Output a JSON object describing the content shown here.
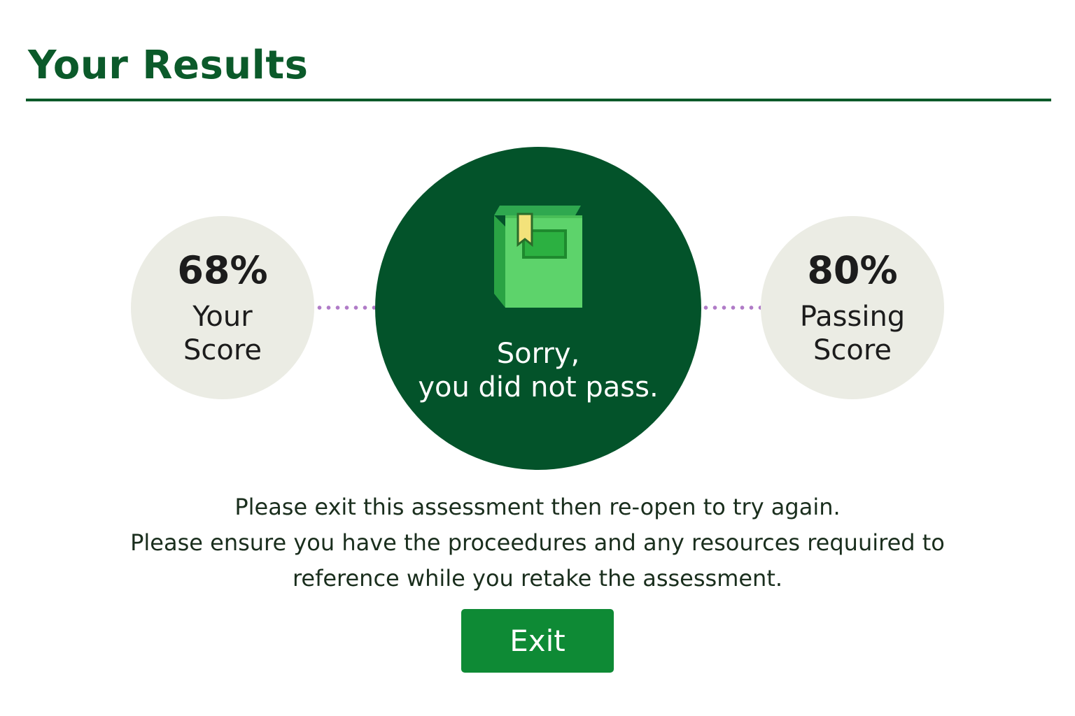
{
  "header": {
    "title": "Your Results"
  },
  "your_score": {
    "value": "68%",
    "label_line1": "Your",
    "label_line2": "Score"
  },
  "passing_score": {
    "value": "80%",
    "label_line1": "Passing",
    "label_line2": "Score"
  },
  "result": {
    "icon": "book-icon",
    "line1": "Sorry,",
    "line2": "you did not pass."
  },
  "instructions": {
    "line1": "Please exit this assessment then re-open to try again.",
    "line2": "Please ensure you have the proceedures and any resources requuired to",
    "line3": "reference while you retake the assessment."
  },
  "actions": {
    "exit_label": "Exit"
  },
  "colors": {
    "brand_dark_green": "#03532a",
    "title_green": "#0b5a2a",
    "button_green": "#0e8a35",
    "stat_circle_bg": "#ebece4",
    "connector_dots": "#b07bc7"
  }
}
